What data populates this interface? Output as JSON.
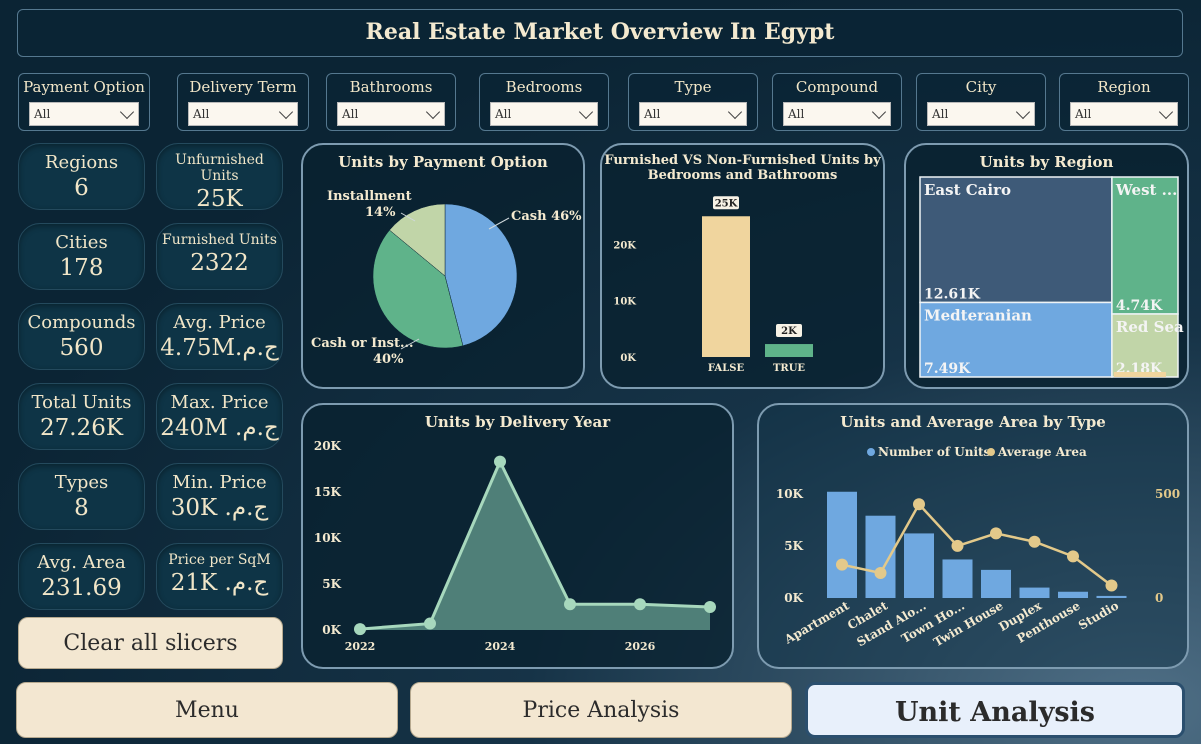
{
  "header": {
    "title": "Real Estate Market Overview In Egypt"
  },
  "slicers": [
    {
      "label": "Payment Option",
      "value": "All"
    },
    {
      "label": "Delivery Term",
      "value": "All"
    },
    {
      "label": "Bathrooms",
      "value": "All"
    },
    {
      "label": "Bedrooms",
      "value": "All"
    },
    {
      "label": "Type",
      "value": "All"
    },
    {
      "label": "Compound",
      "value": "All"
    },
    {
      "label": "City",
      "value": "All"
    },
    {
      "label": "Region",
      "value": "All"
    }
  ],
  "kpis": {
    "regions": {
      "label": "Regions",
      "value": "6"
    },
    "unfurnished": {
      "label": "Unfurnished Units",
      "value": "25K"
    },
    "cities": {
      "label": "Cities",
      "value": "178"
    },
    "furnished": {
      "label": "Furnished Units",
      "value": "2322"
    },
    "compounds": {
      "label": "Compounds",
      "value": "560"
    },
    "avg_price": {
      "label": "Avg. Price",
      "value": "4.75M.ج.م"
    },
    "total_units": {
      "label": "Total Units",
      "value": "27.26K"
    },
    "max_price": {
      "label": "Max. Price",
      "value": "240M .ج.م"
    },
    "types": {
      "label": "Types",
      "value": "8"
    },
    "min_price": {
      "label": "Min. Price",
      "value": "30K .ج.م"
    },
    "avg_area": {
      "label": "Avg. Area",
      "value": "231.69"
    },
    "price_sqm": {
      "label": "Price per SqM",
      "value": "21K .ج.م"
    }
  },
  "buttons": {
    "clear": "Clear all slicers",
    "menu": "Menu",
    "price": "Price Analysis",
    "unit": "Unit Analysis"
  },
  "colors": {
    "blue": "#6fa8e0",
    "green": "#5fb38a",
    "sage": "#c1d5a8",
    "sand": "#f0d59e",
    "area": "#4f7f78",
    "line": "#a7d8bd",
    "slate": "#3e5a78",
    "gold": "#e3c98a"
  },
  "chart_data": [
    {
      "id": "payment",
      "type": "pie",
      "title": "Units by Payment Option",
      "slices": [
        {
          "name": "Cash",
          "pct": 46,
          "label": "Cash 46%"
        },
        {
          "name": "Cash or Installment",
          "pct": 40,
          "label": "Cash or Inst...",
          "pct_label": "40%"
        },
        {
          "name": "Installment",
          "pct": 14,
          "label": "Installment",
          "pct_label": "14%"
        }
      ]
    },
    {
      "id": "furnished",
      "type": "bar",
      "title_line1": "Furnished VS Non-Furnished Units by",
      "title_line2": "Bedrooms and Bathrooms",
      "categories": [
        "FALSE",
        "TRUE"
      ],
      "values": [
        25000,
        2300
      ],
      "data_labels": [
        "25K",
        "2K"
      ],
      "yticks": [
        "0K",
        "10K",
        "20K"
      ],
      "ylim": [
        0,
        27000
      ]
    },
    {
      "id": "region",
      "type": "treemap",
      "title": "Units by Region",
      "items": [
        {
          "name": "East Cairo",
          "value": 12.61,
          "label": "12.61K"
        },
        {
          "name": "Medteranian",
          "value": 7.49,
          "label": "7.49K"
        },
        {
          "name": "West ...",
          "value": 4.74,
          "label": "4.74K"
        },
        {
          "name": "Red Sea",
          "value": 2.18,
          "label": "2.18K"
        }
      ]
    },
    {
      "id": "delivery",
      "type": "area",
      "title": "Units by Delivery Year",
      "x": [
        2022,
        2023,
        2024,
        2025,
        2026,
        2027
      ],
      "y": [
        100,
        700,
        18300,
        2800,
        2800,
        2500
      ],
      "xticks": [
        "2022",
        "2024",
        "2026"
      ],
      "yticks": [
        "0K",
        "5K",
        "10K",
        "15K",
        "20K"
      ],
      "ylim": [
        0,
        20000
      ]
    },
    {
      "id": "bytype",
      "type": "bar",
      "title": "Units and Average Area by Type",
      "legend": [
        "Number of Units",
        "Average Area"
      ],
      "categories": [
        "Apartment",
        "Chalet",
        "Stand Alo...",
        "Town Ho...",
        "Twin House",
        "Duplex",
        "Penthouse",
        "Studio"
      ],
      "series": [
        {
          "name": "Number of Units",
          "values": [
            10200,
            7900,
            6200,
            3700,
            2700,
            1000,
            600,
            200
          ]
        },
        {
          "name": "Average Area",
          "values": [
            160,
            120,
            450,
            250,
            310,
            270,
            200,
            60
          ]
        }
      ],
      "yticks_left": [
        "0K",
        "5K",
        "10K"
      ],
      "yticks_right": [
        "0",
        "500"
      ],
      "ylim_left": [
        0,
        12000
      ],
      "ylim_right": [
        0,
        600
      ]
    }
  ]
}
